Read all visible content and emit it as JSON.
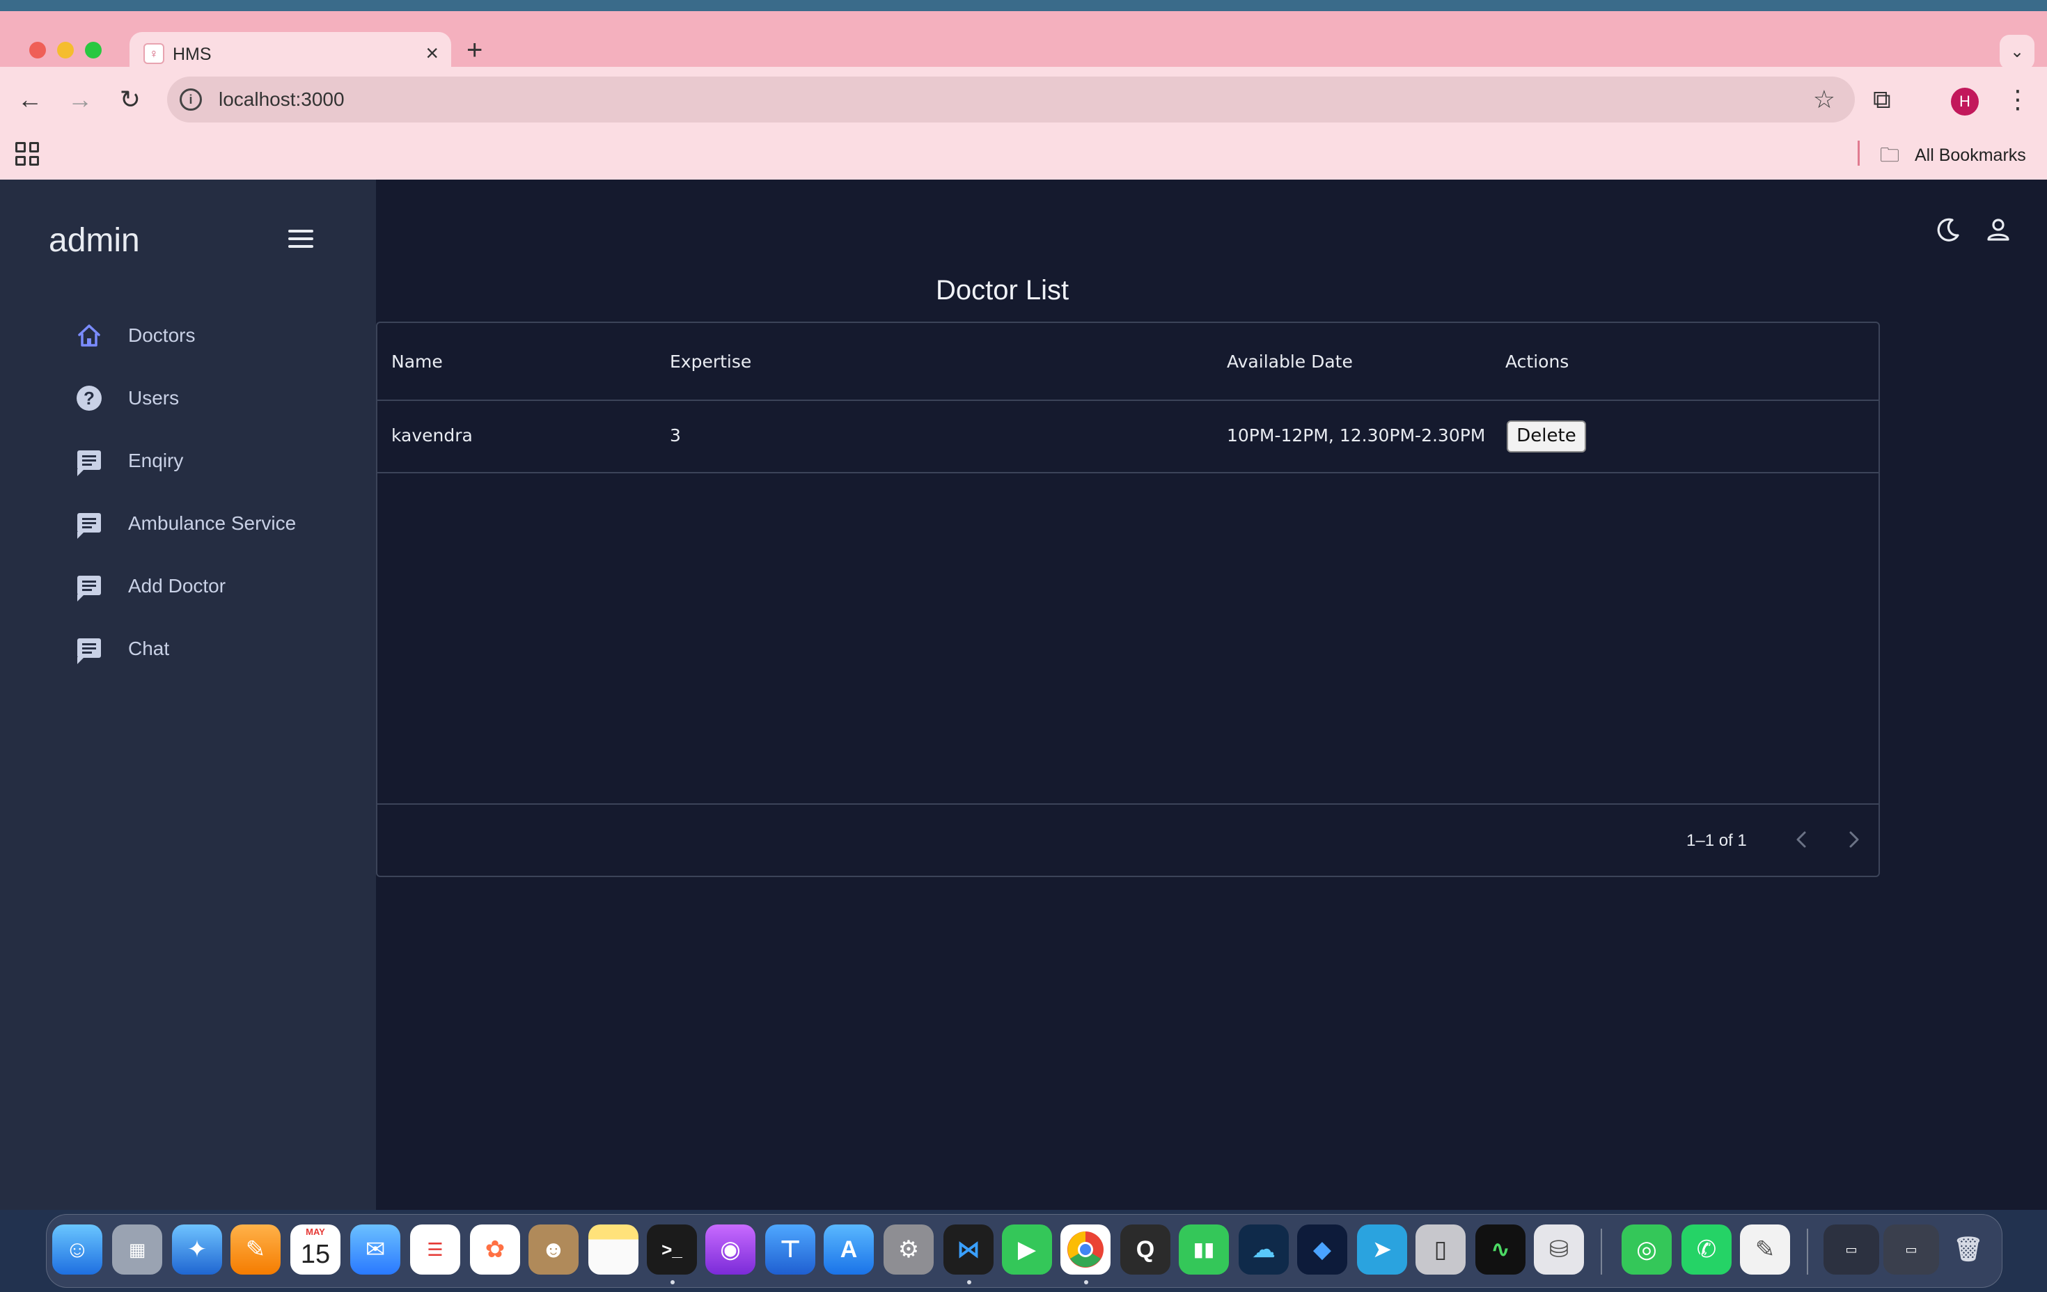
{
  "browser": {
    "tab_title": "HMS",
    "tab_close": "×",
    "new_tab": "+",
    "tab_list": "⌄",
    "url": "localhost:3000",
    "info": "i",
    "star": "☆",
    "extensions": "⧉",
    "profile_initial": "H",
    "menu": "⋮",
    "back": "←",
    "forward": "→",
    "reload": "↻",
    "bookmarks_label": "All Bookmarks",
    "folder_icon": "🗀"
  },
  "app": {
    "brand": "admin",
    "sidebar": {
      "items": [
        {
          "label": "Doctors",
          "icon": "home-icon"
        },
        {
          "label": "Users",
          "icon": "help-icon"
        },
        {
          "label": "Enqiry",
          "icon": "chat-icon"
        },
        {
          "label": "Ambulance Service",
          "icon": "chat-icon"
        },
        {
          "label": "Add Doctor",
          "icon": "chat-icon"
        },
        {
          "label": "Chat",
          "icon": "chat-icon"
        }
      ],
      "help_glyph": "?"
    },
    "page_title": "Doctor List",
    "table": {
      "columns": [
        "Name",
        "Expertise",
        "Available Date",
        "Actions"
      ],
      "rows": [
        {
          "name": "kavendra",
          "expertise": "3",
          "available_date": "10PM-12PM, 12.30PM-2.30PM",
          "action": "Delete"
        }
      ],
      "pagination": "1–1 of 1"
    },
    "colors": {
      "accent": "#7b8cff",
      "sidebar_bg": "#252d42",
      "content_bg": "#151a2e"
    }
  },
  "dock": {
    "calendar_month": "MAY",
    "calendar_day": "15",
    "apps": [
      "Finder",
      "Launchpad",
      "Safari",
      "Pages",
      "Calendar",
      "Mail",
      "Reminders",
      "Photos",
      "Contacts",
      "Notes",
      "Terminal",
      "Podcasts",
      "Keynote",
      "App Store",
      "System Settings",
      "VS Code",
      "FaceTime",
      "Chrome",
      "QuickTime",
      "Numbers",
      "Cloud",
      "Shortcuts",
      "Telegram",
      "iPhone Mirroring",
      "Activity Monitor",
      "Disk Utility",
      "Find My",
      "WhatsApp",
      "TextEdit",
      "Window 1",
      "Window 2",
      "Trash"
    ]
  }
}
